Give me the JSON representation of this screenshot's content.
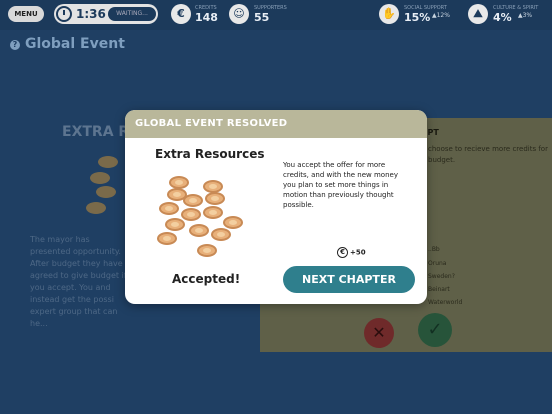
{
  "topbar": {
    "menu_label": "MENU",
    "timer": "1:36",
    "status": "WAITING...",
    "credits_label": "CREDITS",
    "credits_value": "148",
    "supporters_label": "SUPPORTERS",
    "supporters_value": "55",
    "stat1_label": "SOCIAL SUPPORT",
    "stat1_value": "15%",
    "stat1_delta": "▲12%",
    "stat2_label": "CULTURE & SPIRIT",
    "stat2_value": "4%",
    "stat2_delta": "▲3%"
  },
  "page": {
    "global_title": "Global Event",
    "help_glyph": "?"
  },
  "background": {
    "heading": "EXTRA RE...",
    "body": "The mayor has presented opportunity. After budget they have agreed to give budget if you accept. You and instead get the possi expert group that can he...",
    "card_heading": "EPT",
    "card_text": "choose to recieve more credits for budget.",
    "card_items": [
      "..Bb",
      "Oruna",
      "Sweden?",
      "Beinart",
      "Waterworld"
    ]
  },
  "modal": {
    "header_title": "GLOBAL EVENT RESOLVED",
    "event_name": "Extra Resources",
    "result": "Accepted!",
    "outcome_text": "You accept the offer for more credits, and with the new money you plan to set more things in motion than previously thought possible.",
    "credit_change": "+50",
    "next_button": "NEXT CHAPTER"
  },
  "colors": {
    "header_bg": "#b9b79a",
    "next_button_bg": "#2f7f8d",
    "page_bg": "#1f3f63"
  }
}
